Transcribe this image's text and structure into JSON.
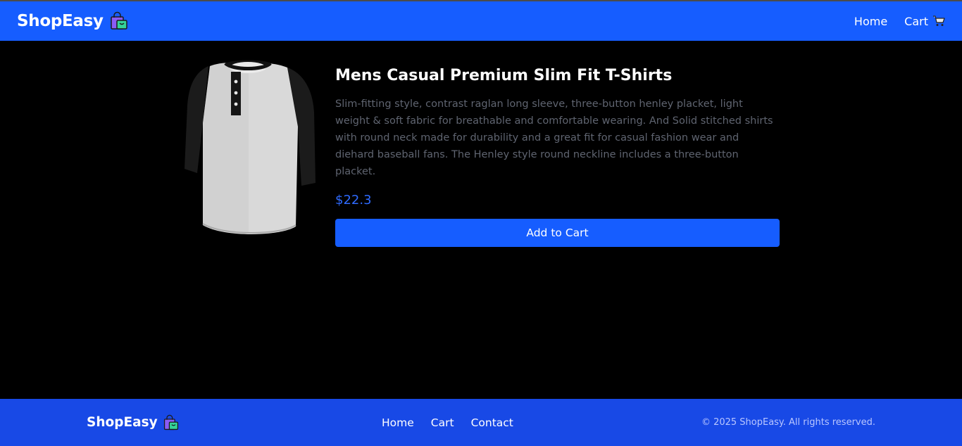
{
  "header": {
    "brand": "ShopEasy",
    "brand_icon": "shopping-bags-icon",
    "nav": [
      {
        "label": "Home"
      },
      {
        "label": "Cart",
        "icon": "shopping-cart-icon"
      }
    ]
  },
  "product": {
    "title": "Mens Casual Premium Slim Fit T-Shirts",
    "description": "Slim-fitting style, contrast raglan long sleeve, three-button henley placket, light weight & soft fabric for breathable and comfortable wearing. And Solid stitched shirts with round neck made for durability and a great fit for casual fashion wear and diehard baseball fans. The Henley style round neckline includes a three-button placket.",
    "price": "$22.3",
    "add_to_cart_label": "Add to Cart",
    "image_alt": "raglan henley t-shirt"
  },
  "footer": {
    "brand": "ShopEasy",
    "links": [
      {
        "label": "Home"
      },
      {
        "label": "Cart"
      },
      {
        "label": "Contact"
      }
    ],
    "copyright": "© 2025 ShopEasy. All rights reserved."
  },
  "colors": {
    "primary": "#165dff",
    "footer_bg": "#1849e6",
    "page_bg": "#000000",
    "price": "#2f6bff",
    "description_text": "#5f6470"
  }
}
